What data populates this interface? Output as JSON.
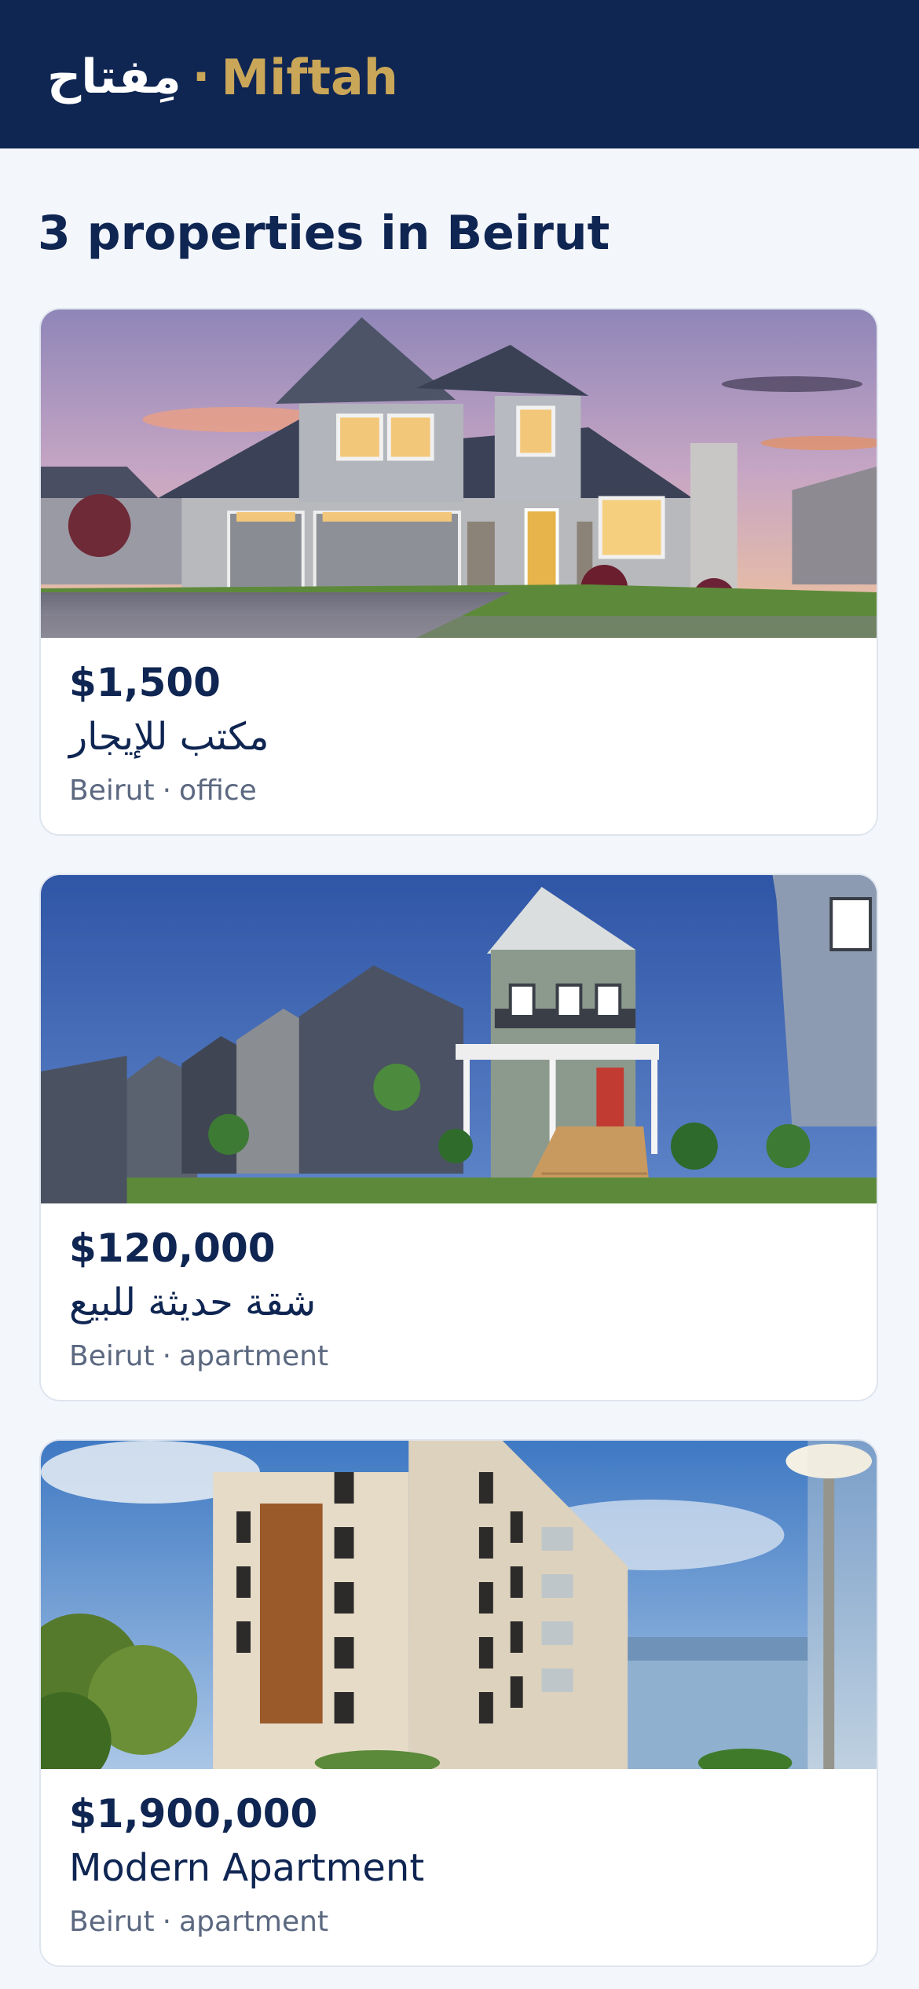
{
  "header": {
    "logo_arabic": "مِفتاح",
    "logo_separator": "·",
    "logo_latin": "Miftah"
  },
  "results": {
    "title": "3 properties in Beirut"
  },
  "listings": [
    {
      "price": "$1,500",
      "title": "مكتب للإيجار",
      "city": "Beirut",
      "separator": "·",
      "type": "office",
      "photo": "two-storey suburban house at sunset"
    },
    {
      "price": "$120,000",
      "title": "شقة حديثة للبيع",
      "city": "Beirut",
      "separator": "·",
      "type": "apartment",
      "photo": "row of townhouses with porches under blue sky"
    },
    {
      "price": "$1,900,000",
      "title": "Modern Apartment",
      "city": "Beirut",
      "separator": "·",
      "type": "apartment",
      "photo": "modern apartment building with wood panel facade"
    }
  ],
  "colors": {
    "header_bg": "#0f2552",
    "accent_gold": "#c9a658",
    "page_bg": "#f3f6fb",
    "text_primary": "#0f2552",
    "text_muted": "#5b6880"
  }
}
